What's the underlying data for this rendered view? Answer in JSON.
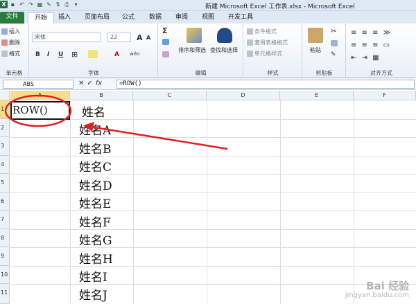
{
  "window": {
    "title": "新建 Microsoft Excel 工作表.xlsx - Microsoft Excel"
  },
  "tabs": {
    "file": "文件",
    "items": [
      "开始",
      "插入",
      "页面布局",
      "公式",
      "数据",
      "审阅",
      "视图",
      "开发工具"
    ]
  },
  "ribbon": {
    "cells_group": {
      "label": "单元格",
      "insert": "插入",
      "delete": "删除",
      "format": "格式"
    },
    "font_group": {
      "label": "字体",
      "font_name": "宋体",
      "font_size": "22",
      "font_grow": "A",
      "font_shrink": "A",
      "bold": "B",
      "italic": "I",
      "underline": "U",
      "border_glyph": "⊞",
      "wen_glyph": "wén",
      "font_color": "A"
    },
    "editing_group": {
      "label": "编辑",
      "sum_glyph": "Σ",
      "sort_filter": "排序和筛选",
      "find_select": "查找和选择"
    },
    "styles_group": {
      "label": "样式",
      "conditional": "条件格式",
      "table_format": "套用表格格式",
      "cell_styles": "单元格样式"
    },
    "clipboard_group": {
      "label": "剪贴板",
      "paste": "粘贴"
    },
    "alignment_group": {
      "label": "对齐方式"
    }
  },
  "formula_bar": {
    "name_box": "ABS",
    "cancel_glyph": "✕",
    "enter_glyph": "✓",
    "fx_glyph": "fx",
    "formula": "=ROW()"
  },
  "grid": {
    "columns": [
      "A",
      "B",
      "C",
      "D",
      "E",
      "F"
    ],
    "rows": [
      "1",
      "2",
      "3",
      "4",
      "5",
      "6",
      "7",
      "8",
      "9",
      "10",
      "11"
    ],
    "a1_edit": "ROW()",
    "b_values": [
      "姓名",
      "姓名A",
      "姓名B",
      "姓名C",
      "姓名D",
      "姓名E",
      "姓名F",
      "姓名G",
      "姓名H",
      "姓名I",
      "姓名J"
    ]
  },
  "annotation": {
    "color": "#e02020"
  },
  "watermark": {
    "brand": "Bai 经验",
    "url": "jingyan.baidu.com"
  }
}
